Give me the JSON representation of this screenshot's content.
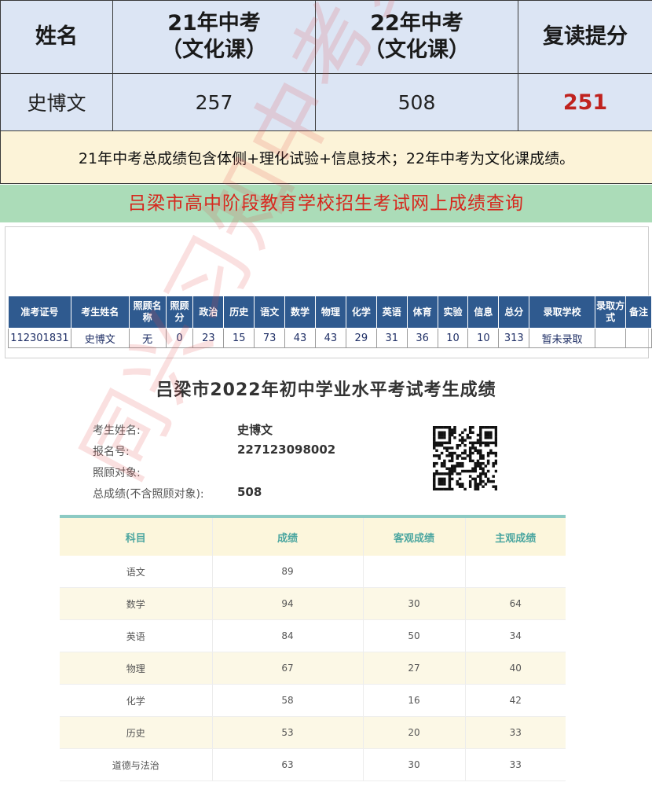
{
  "comparison": {
    "headers": {
      "name": "姓名",
      "y21_line1": "21年中考",
      "y21_line2": "（文化课）",
      "y22_line1": "22年中考",
      "y22_line2": "（文化课）",
      "improve": "复读提分"
    },
    "row": {
      "name": "史博文",
      "y21": "257",
      "y22": "508",
      "improve": "251"
    },
    "note": "21年中考总成绩包含体侧+理化试验+信息技术；22年中考为文化课成绩。",
    "colors": {
      "header_bg": "#dce5f4",
      "note_bg": "#fcf3d8",
      "improve": "#c0221e"
    }
  },
  "banner": {
    "title": "吕梁市高中阶段教育学校招生考试网上成绩查询"
  },
  "query": {
    "columns": [
      "准考证号",
      "考生姓名",
      "照顾名称",
      "照顾分",
      "政治",
      "历史",
      "语文",
      "数学",
      "物理",
      "化学",
      "英语",
      "体育",
      "实验",
      "信息",
      "总分",
      "录取学校",
      "录取方式",
      "备注"
    ],
    "row": [
      "112301831",
      "史博文",
      "无",
      "0",
      "23",
      "15",
      "73",
      "43",
      "43",
      "29",
      "31",
      "36",
      "10",
      "10",
      "313",
      "暂未录取",
      "",
      ""
    ]
  },
  "score_page": {
    "title": "吕梁市2022年初中学业水平考试考生成绩",
    "info": [
      {
        "label": "考生姓名:",
        "value": "史博文"
      },
      {
        "label": "报名号:",
        "value": "227123098002"
      },
      {
        "label": "照顾对象:",
        "value": ""
      },
      {
        "label": "总成绩(不含照顾对象):",
        "value": "508"
      }
    ],
    "columns": [
      "科目",
      "成绩",
      "客观成绩",
      "主观成绩"
    ],
    "rows": [
      [
        "语文",
        "89",
        "",
        ""
      ],
      [
        "数学",
        "94",
        "30",
        "64"
      ],
      [
        "英语",
        "84",
        "50",
        "34"
      ],
      [
        "物理",
        "67",
        "27",
        "40"
      ],
      [
        "化学",
        "58",
        "16",
        "42"
      ],
      [
        "历史",
        "53",
        "20",
        "33"
      ],
      [
        "道德与法治",
        "63",
        "30",
        "33"
      ]
    ],
    "watermark": "同兴习知中考复读",
    "colors": {
      "header_text": "#4ba6a0",
      "accent_line": "#8ccac3"
    }
  }
}
